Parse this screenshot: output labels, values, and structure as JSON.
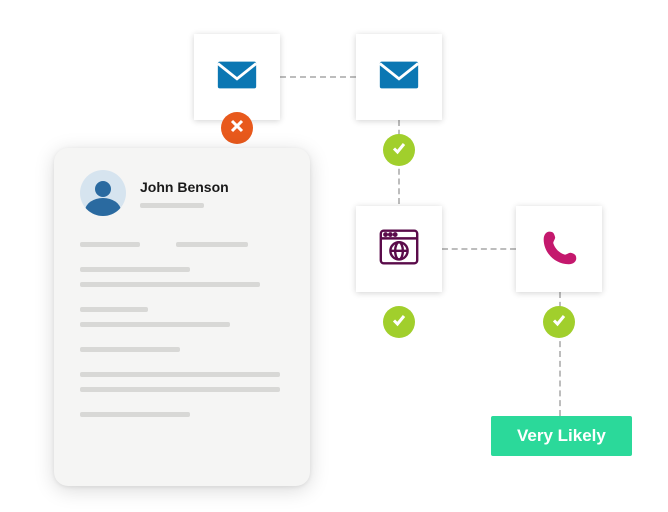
{
  "document": {
    "name": "John Benson"
  },
  "nodes": {
    "email1": {
      "icon": "mail-icon",
      "status": "fail"
    },
    "email2": {
      "icon": "mail-icon",
      "status": "ok"
    },
    "web": {
      "icon": "browser-globe-icon",
      "status": "ok"
    },
    "phone": {
      "icon": "phone-icon",
      "status": "ok"
    }
  },
  "result": {
    "label": "Very Likely"
  },
  "colors": {
    "mail": "#0b77b3",
    "web": "#5a0b4a",
    "phone": "#c4186d",
    "pill": "#2bd99a",
    "ok": "#a1cf2c",
    "fail": "#e8591c"
  }
}
